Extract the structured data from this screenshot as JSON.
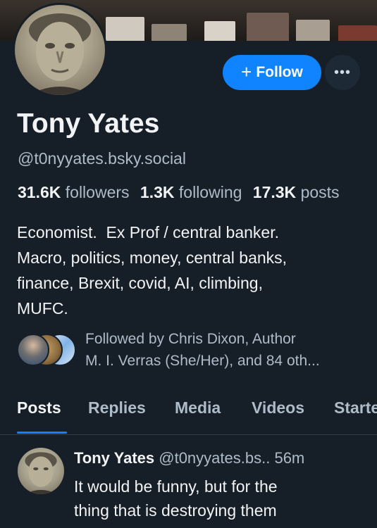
{
  "profile": {
    "display_name": "Tony Yates",
    "handle": "@t0nyyates.bsky.social",
    "follow_label": "Follow",
    "follow_icon": "plus-icon",
    "more_icon": "ellipsis-icon",
    "more_glyph": "•••"
  },
  "stats": {
    "followers_count": "31.6K",
    "followers_label": "followers",
    "following_count": "1.3K",
    "following_label": "following",
    "posts_count": "17.3K",
    "posts_label": "posts"
  },
  "bio": {
    "lines": [
      "Economist.  Ex Prof / central banker.",
      "Macro, politics, money, central banks,",
      "finance, Brexit, covid, AI, climbing,",
      "MUFC."
    ]
  },
  "followed_by": {
    "line1": "Followed by Chris Dixon, Author",
    "line2": "M. I. Verras (She/Her), and 84 oth..."
  },
  "tabs": [
    {
      "label": "Posts",
      "active": true
    },
    {
      "label": "Replies",
      "active": false
    },
    {
      "label": "Media",
      "active": false
    },
    {
      "label": "Videos",
      "active": false
    },
    {
      "label": "Starter",
      "active": false
    }
  ],
  "post": {
    "author": "Tony Yates",
    "handle": "@t0nyyates.bs..",
    "time": "56m",
    "text_lines": [
      "It would be funny, but for the",
      "thing that is destroying them"
    ]
  },
  "colors": {
    "background": "#161e27",
    "accent": "#1083fe",
    "muted_text": "#aebbc9"
  }
}
